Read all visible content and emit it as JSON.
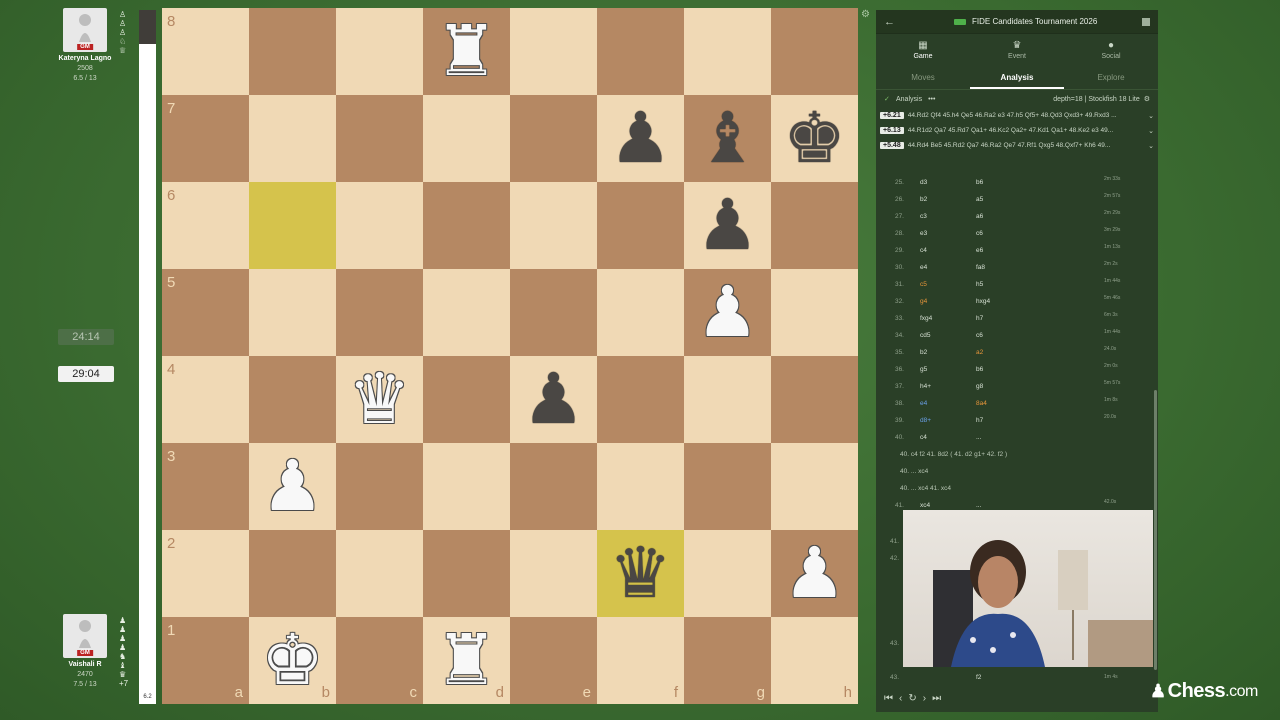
{
  "players": {
    "top": {
      "name": "Kateryna Lagno",
      "title": "GM",
      "rating": "2508",
      "score": "6.5 / 13"
    },
    "bottom": {
      "name": "Vaishali R",
      "title": "GM",
      "rating": "2470",
      "score": "7.5 / 13",
      "score_diff": "+7"
    }
  },
  "clocks": {
    "top": "24:14",
    "bottom": "29:04"
  },
  "eval_bar": {
    "label": "6.2",
    "white_share": 0.95
  },
  "board": {
    "ranks": [
      "8",
      "7",
      "6",
      "5",
      "4",
      "3",
      "2",
      "1"
    ],
    "files": [
      "a",
      "b",
      "c",
      "d",
      "e",
      "f",
      "g",
      "h"
    ],
    "highlight": [
      "b6",
      "f2"
    ],
    "pieces": [
      {
        "sq": "d8",
        "type": "rook",
        "color": "white"
      },
      {
        "sq": "f7",
        "type": "pawn",
        "color": "black"
      },
      {
        "sq": "g7",
        "type": "bishop",
        "color": "black"
      },
      {
        "sq": "h7",
        "type": "king",
        "color": "black"
      },
      {
        "sq": "g6",
        "type": "pawn",
        "color": "black"
      },
      {
        "sq": "g5",
        "type": "pawn",
        "color": "white"
      },
      {
        "sq": "c4",
        "type": "queen",
        "color": "white"
      },
      {
        "sq": "e4",
        "type": "pawn",
        "color": "black"
      },
      {
        "sq": "b3",
        "type": "pawn",
        "color": "white"
      },
      {
        "sq": "f2",
        "type": "queen",
        "color": "black"
      },
      {
        "sq": "h2",
        "type": "pawn",
        "color": "white"
      },
      {
        "sq": "b1",
        "type": "king",
        "color": "white"
      },
      {
        "sq": "d1",
        "type": "rook",
        "color": "white"
      }
    ]
  },
  "panel": {
    "title": "FIDE Candidates Tournament 2026",
    "tabs": [
      {
        "label": "Game",
        "icon": "board-icon"
      },
      {
        "label": "Event",
        "icon": "trophy-icon"
      },
      {
        "label": "Social",
        "icon": "chat-icon"
      }
    ],
    "subtabs": [
      "Moves",
      "Analysis",
      "Explore"
    ],
    "analysis_label": "Analysis",
    "engine_info": "depth=18 | Stockfish 18 Lite",
    "lines": [
      {
        "eval": "+6.21",
        "moves": "44.Rd2 Qf4 45.h4 Qe5 46.Ra2 e3 47.h5 Qf5+ 48.Qd3 Qxd3+ 49.Rxd3 ..."
      },
      {
        "eval": "+6.13",
        "moves": "44.R1d2 Qa7 45.Rd7 Qa1+ 46.Kc2 Qa2+ 47.Kd1 Qa1+ 48.Ke2 e3 49..."
      },
      {
        "eval": "+5.48",
        "moves": "44.Rd4 Be5 45.Rd2 Qa7 46.Ra2 Qe7 47.Rf1 Qxg5 48.Qxf7+ Kh6 49..."
      }
    ],
    "moves": [
      {
        "n": "25.",
        "w": "d3",
        "b": "b6",
        "t": "2m 33s"
      },
      {
        "n": "26.",
        "w": "b2",
        "b": "a5",
        "t": "2m 57s"
      },
      {
        "n": "27.",
        "w": "c3",
        "b": "a6",
        "t": "2m 29s"
      },
      {
        "n": "28.",
        "w": "e3",
        "b": "c6",
        "t": "3m 29s"
      },
      {
        "n": "29.",
        "w": "c4",
        "b": "e6",
        "t": "1m 13s"
      },
      {
        "n": "30.",
        "w": "e4",
        "b": "fa8",
        "t": "2m 2s"
      },
      {
        "n": "31.",
        "w": "c5",
        "b": "h5",
        "t": "1m 44s",
        "wh": true
      },
      {
        "n": "32.",
        "w": "g4",
        "b": "hxg4",
        "t": "5m 46s",
        "wh": true
      },
      {
        "n": "33.",
        "w": "fxg4",
        "b": "h7",
        "t": "6m 3s"
      },
      {
        "n": "34.",
        "w": "cd5",
        "b": "c6",
        "t": "1m 44s"
      },
      {
        "n": "35.",
        "w": "b2",
        "b": "a2",
        "t": "24.0s",
        "bh": true
      },
      {
        "n": "36.",
        "w": "g5",
        "b": "b6",
        "t": "2m 0s"
      },
      {
        "n": "37.",
        "w": "h4+",
        "b": "g8",
        "t": "5m 57s"
      },
      {
        "n": "38.",
        "w": "e4",
        "b": "8a4",
        "t": "1m 8s",
        "wblue": true,
        "bh": true
      },
      {
        "n": "39.",
        "w": "d8+",
        "b": "h7",
        "t": "20.0s",
        "wblue": true
      },
      {
        "n": "40.",
        "w": "c4",
        "b": "...",
        "t": ""
      }
    ],
    "variations": [
      "40. c4  f2  41. 8d2 ( 41. d2  g1+  42.  f2 )",
      "40. ...  xc4",
      "40. ... xc4  41. xc4"
    ],
    "extra_moves": [
      {
        "n": "41.",
        "w": "xc4",
        "b": "...",
        "t": "42.0s"
      }
    ],
    "tail_numbers": [
      "41.",
      "42.",
      "43.",
      "43."
    ],
    "last_move": "f2",
    "last_time": "1m 4s"
  },
  "brand": {
    "name": "Chess",
    "suffix": ".com"
  },
  "colors": {
    "light_square": "#f0d9b5",
    "dark_square": "#b58863",
    "highlight": "#d5c34c",
    "panel": "#2a3f27"
  }
}
